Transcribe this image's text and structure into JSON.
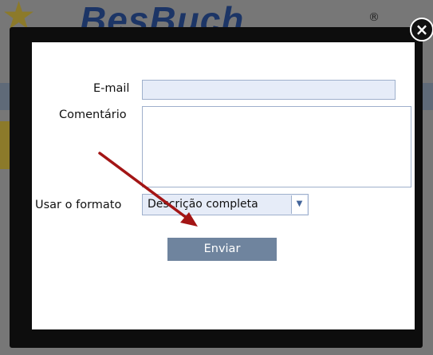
{
  "background": {
    "logo_text": "BesBuch",
    "reg_mark": "®"
  },
  "modal": {
    "close_glyph": "×",
    "email_label": "E-mail",
    "email_value": "",
    "comment_label": "Comentário",
    "comment_value": "",
    "format_label": "Usar o formato",
    "format_selected": "Descrição completa",
    "submit_label": "Enviar"
  },
  "colors": {
    "overlay": "#0d0d0d",
    "input_bg": "#e6ecf8",
    "button_bg": "#6f849e",
    "annotation_arrow": "#a31515"
  },
  "icons": {
    "close": "close-icon",
    "dropdown": "chevron-down-icon",
    "annotation": "arrow-icon"
  }
}
